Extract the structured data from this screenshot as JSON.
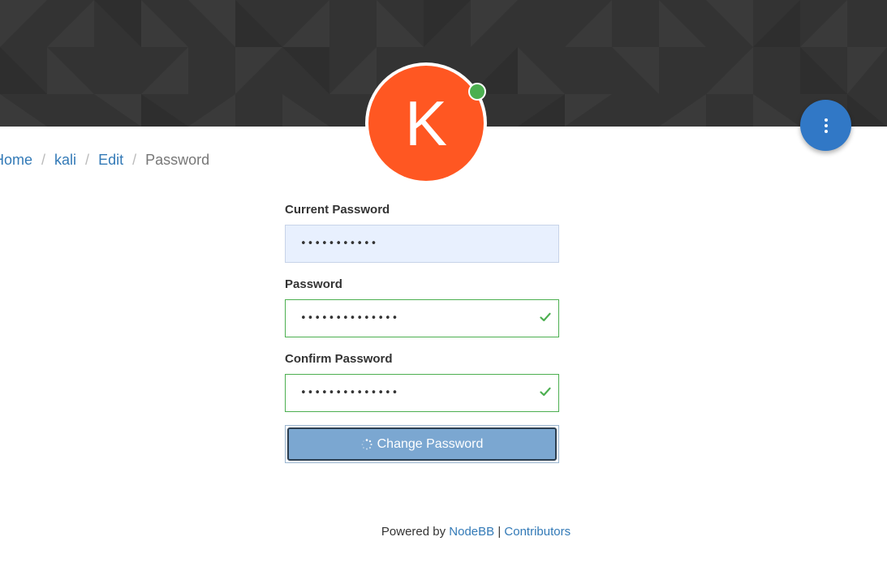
{
  "profile": {
    "avatar_letter": "K",
    "avatar_color": "#ff5722",
    "status": "online",
    "status_color": "#4caf50"
  },
  "menu_button": {
    "icon": "vertical-ellipsis-icon",
    "color": "#3178c6"
  },
  "breadcrumb": {
    "items": [
      {
        "label": "Home"
      },
      {
        "label": "kali"
      },
      {
        "label": "Edit"
      },
      {
        "label": "Password"
      }
    ],
    "separator": "/"
  },
  "form": {
    "current_password": {
      "label": "Current Password",
      "value": "•••••••••••"
    },
    "password": {
      "label": "Password",
      "value": "••••••••••••••",
      "valid_icon": "checkmark-icon"
    },
    "confirm_password": {
      "label": "Confirm Password",
      "value": "••••••••••••••",
      "valid_icon": "checkmark-icon"
    },
    "submit_label": "Change Password",
    "submit_icon": "spinner-icon"
  },
  "footer": {
    "prefix": "Powered by",
    "link1": "NodeBB",
    "separator": "|",
    "link2": "Contributors"
  },
  "colors": {
    "cover_bg": "#333333",
    "link": "#337ab7",
    "valid": "#4caf50",
    "button_bg": "#7ba7d1"
  }
}
